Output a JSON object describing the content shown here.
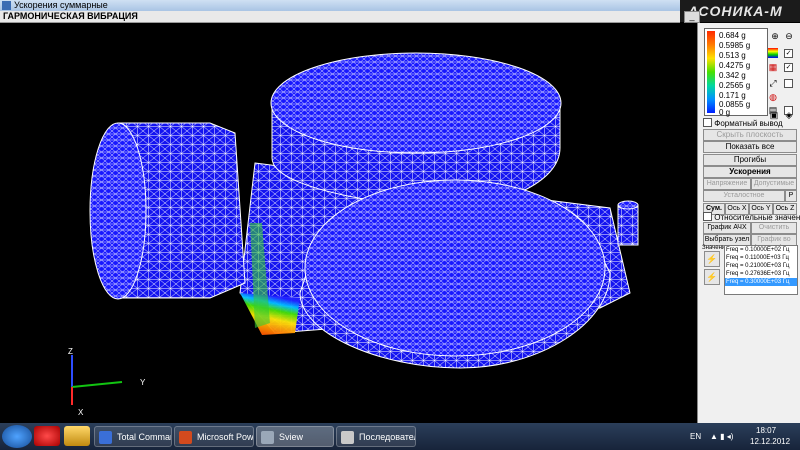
{
  "window": {
    "title": "Ускорения суммарные",
    "header": "ГАРМОНИЧЕСКАЯ ВИБРАЦИЯ",
    "logo": "АСОНИКА-М",
    "controls": {
      "minimize": "_",
      "close": "x"
    }
  },
  "viewport": {
    "axes": {
      "z": "Z",
      "y": "Y",
      "x": "X"
    },
    "colors": {
      "mesh_fill": "#1a1aff",
      "mesh_line": "#ffffff",
      "background": "#000000"
    }
  },
  "legend": {
    "values": [
      "0.684 g",
      "0.5985 g",
      "0.513 g",
      "0.4275 g",
      "0.342 g",
      "0.2565 g",
      "0.171 g",
      "0.0855 g",
      "0 g"
    ]
  },
  "panel": {
    "format_output": "Форматный вывод",
    "hide_plane": "Скрыть плоскость",
    "show_all": "Показать все",
    "deflections": "Прогибы",
    "accelerations": "Ускорения",
    "stresses": "Напряжение",
    "allowable": "Допустимые",
    "fatigue": "Усталостное разрушение",
    "fatigue_p": "P",
    "sum": "Сум.",
    "axis_x": "Ось X",
    "axis_y": "Ось Y",
    "axis_z": "Ось Z",
    "relative": "Относительные значения",
    "graph_afc": "График АЧХ",
    "clear": "Очистить",
    "select_node": "Выбрать узел",
    "graph_time": "График во врем",
    "freq_title": "Значения частоты (времени)",
    "frequencies": [
      "Freq = 0.10000E+02 Гц",
      "Freq = 0.11000E+03 Гц",
      "Freq = 0.21000E+03 Гц",
      "Freq = 0.27636E+03 Гц",
      "Freq = 0.30000E+03 Гц"
    ],
    "selected_frequency_index": 4
  },
  "taskbar": {
    "tasks": [
      "Total Commande...",
      "Microsoft PowerP...",
      "Sview",
      "Последовательн..."
    ],
    "lang": "EN",
    "time": "18:07",
    "date": "12.12.2012"
  }
}
